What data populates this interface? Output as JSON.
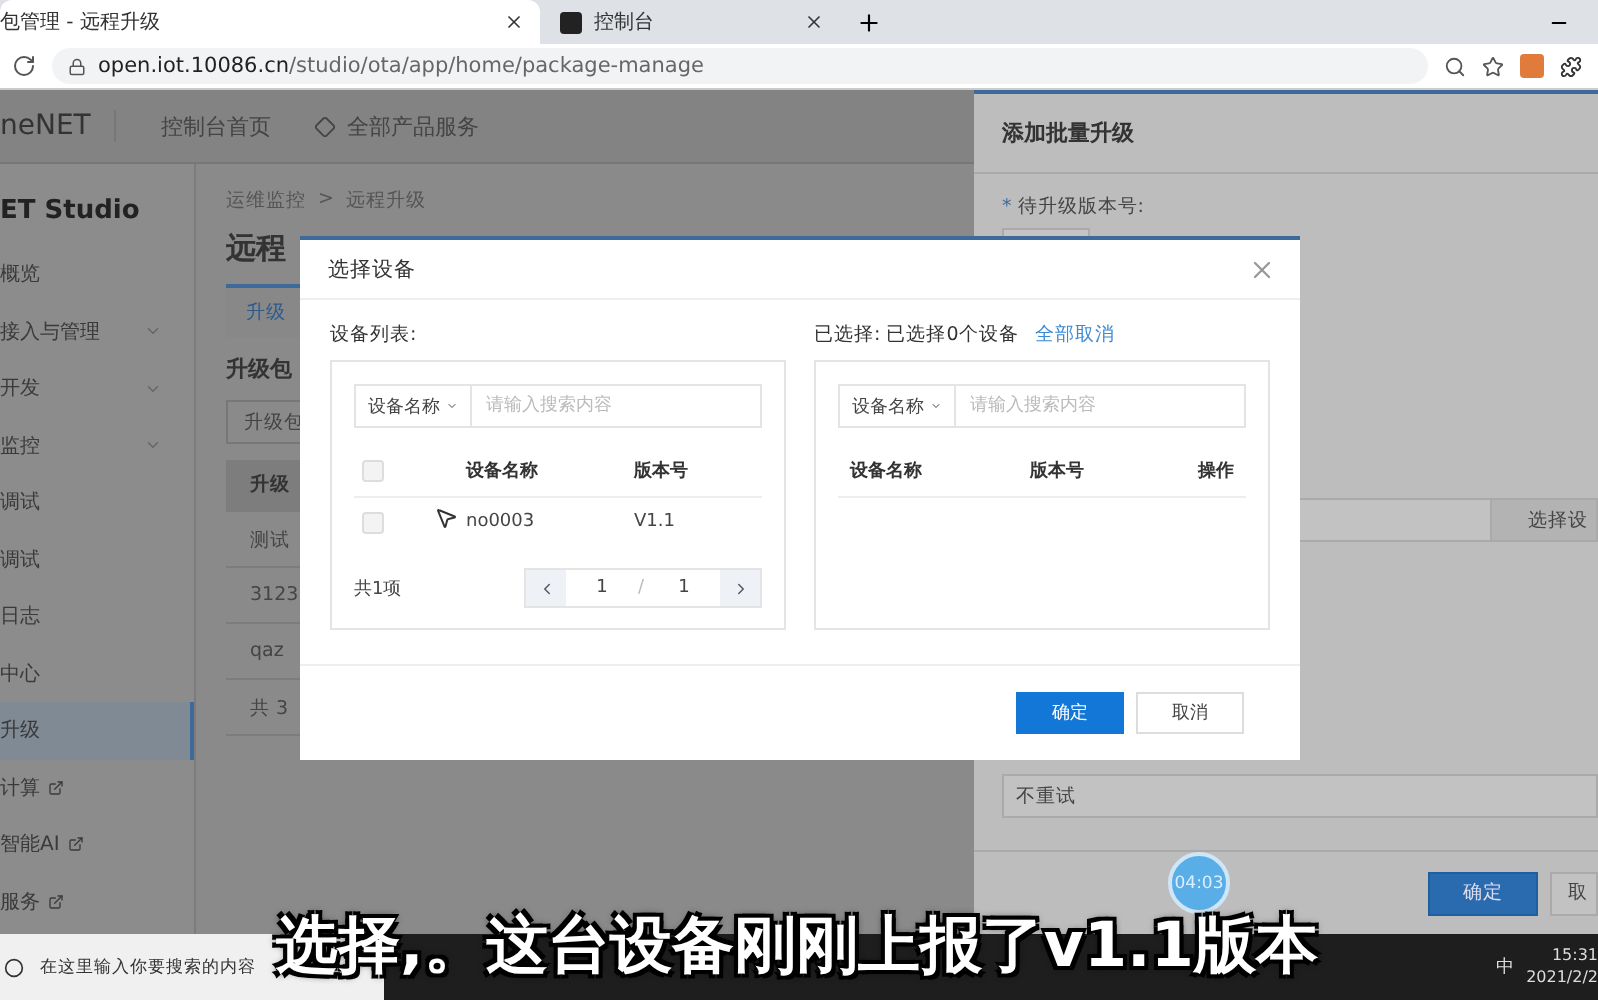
{
  "browser": {
    "tabs": [
      {
        "title": "包管理 - 远程升级",
        "selected": true
      },
      {
        "title": "控制台",
        "selected": false
      }
    ],
    "url_host": "open.iot.10086.cn",
    "url_path": "/studio/ota/app/home/package-manage"
  },
  "header": {
    "logo": "neNET",
    "nav": [
      "控制台首页",
      "全部产品服务"
    ]
  },
  "sidebar": {
    "title": "ET Studio",
    "items": [
      {
        "label": "概览",
        "selected": false,
        "external": false,
        "expandable": false
      },
      {
        "label": "接入与管理",
        "selected": false,
        "external": false,
        "expandable": true
      },
      {
        "label": "开发",
        "selected": false,
        "external": false,
        "expandable": true
      },
      {
        "label": "监控",
        "selected": false,
        "external": false,
        "expandable": true
      },
      {
        "label": "调试",
        "selected": false,
        "external": false,
        "expandable": false
      },
      {
        "label": "调试",
        "selected": false,
        "external": false,
        "expandable": false
      },
      {
        "label": "日志",
        "selected": false,
        "external": false,
        "expandable": false
      },
      {
        "label": "中心",
        "selected": false,
        "external": false,
        "expandable": false
      },
      {
        "label": "升级",
        "selected": true,
        "external": false,
        "expandable": false
      },
      {
        "label": "计算",
        "selected": false,
        "external": true,
        "expandable": false
      },
      {
        "label": "智能AI",
        "selected": false,
        "external": true,
        "expandable": false
      },
      {
        "label": "服务",
        "selected": false,
        "external": true,
        "expandable": false
      }
    ]
  },
  "main": {
    "breadcrumb": [
      "运维监控",
      "远程升级"
    ],
    "breadcrumb_separator": ">",
    "title": "远程",
    "tab": "升级",
    "section": "升级包",
    "filter": "升级包",
    "column": "升级",
    "rows": [
      "测试",
      "3123",
      "qaz"
    ],
    "total": "共 3"
  },
  "drawer": {
    "title": "添加批量升级",
    "required_mark": "*",
    "version_label": "待升级版本号:",
    "select_button": "选择设",
    "retry_value": "不重试",
    "buttons": [
      "确定",
      "取"
    ]
  },
  "modal": {
    "title": "选择设备",
    "left": {
      "label": "设备列表:",
      "filter": "设备名称",
      "placeholder": "请输入搜索内容",
      "columns": [
        "设备名称",
        "版本号"
      ],
      "select_all_checked": false,
      "page_separator": "/",
      "rows": [
        {
          "name": "no0003",
          "version": "V1.1",
          "checked": false
        }
      ],
      "total": "共1项",
      "page": "1",
      "pages": "1"
    },
    "right": {
      "label": "已选择: 已选择0个设备",
      "clear_link": "全部取消",
      "filter": "设备名称",
      "placeholder": "请输入搜索内容",
      "columns": [
        "设备名称",
        "版本号",
        "操作"
      ]
    },
    "buttons": [
      {
        "label": "确定",
        "kind": "primary"
      },
      {
        "label": "取消",
        "kind": "default"
      }
    ]
  },
  "timer": "04:03",
  "subtitle": "选择,。这台设备刚刚上报了v1.1版本",
  "taskbar": {
    "search_placeholder": "在这里输入你要搜索的内容",
    "ime": "中",
    "time": "15:31",
    "date": "2021/2/2"
  }
}
